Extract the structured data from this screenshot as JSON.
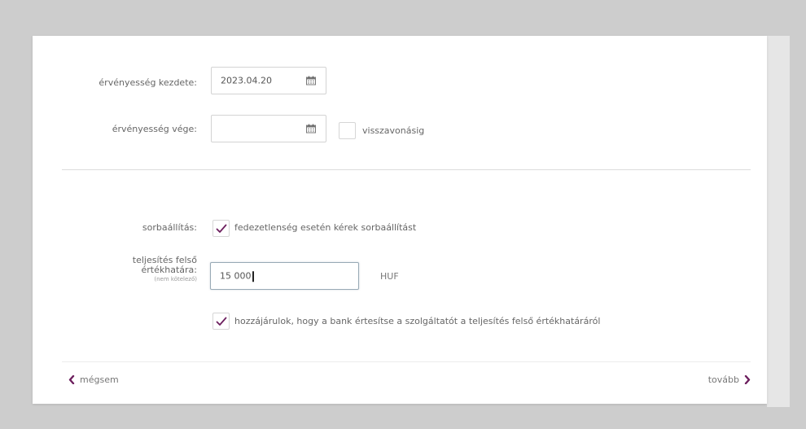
{
  "form": {
    "validity_start": {
      "label": "érvényesség kezdete:",
      "value": "2023.04.20",
      "icon": "calendar-icon"
    },
    "validity_end": {
      "label": "érvényesség vége:",
      "value": "",
      "icon": "calendar-icon",
      "revocation_label": "visszavonásig",
      "revocation_checked": false
    },
    "queueing": {
      "label": "sorbaállítás:",
      "checkbox_label": "fedezetlenség esetén kérek sorbaállítást",
      "checked": true
    },
    "upper_limit": {
      "label_line1": "teljesítés felső",
      "label_line2": "értékhatára:",
      "label_note": "(nem kötelező)",
      "value": "15 000",
      "unit": "HUF"
    },
    "consent": {
      "checkbox_label": "hozzájárulok, hogy a bank értesítse a szolgáltatót a teljesítés felső értékhatáráról",
      "checked": true
    }
  },
  "nav": {
    "back_label": "mégsem",
    "next_label": "tovább"
  },
  "colors": {
    "accent": "#6d1f5e",
    "background": "#cdcdcd",
    "panel": "#ffffff"
  }
}
